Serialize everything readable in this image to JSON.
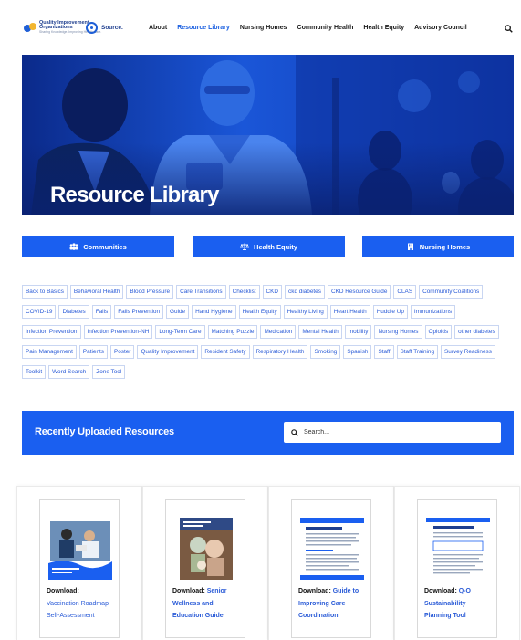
{
  "header": {
    "logo_line1": "Quality Improvement",
    "logo_line2": "Organizations",
    "logo_line3": "Sharing Knowledge. Improving Health Care.",
    "partner": "Source.",
    "nav": [
      "About",
      "Resource Library",
      "Nursing Homes",
      "Community Health",
      "Health Equity",
      "Advisory Council"
    ],
    "active_nav": "Resource Library",
    "search_icon": "search-icon"
  },
  "hero": {
    "title": "Resource Library"
  },
  "categories": [
    {
      "label": "Communities",
      "icon": "people-group-icon"
    },
    {
      "label": "Health Equity",
      "icon": "balance-scale-icon"
    },
    {
      "label": "Nursing Homes",
      "icon": "building-icon"
    }
  ],
  "tags": [
    "Back to Basics",
    "Behavioral Health",
    "Blood Pressure",
    "Care Transitions",
    "Checklist",
    "CKD",
    "ckd diabetes",
    "CKD Resource Guide",
    "CLAS",
    "Community Coalitions",
    "COVID-19",
    "Diabetes",
    "Falls",
    "Falls Prevention",
    "Guide",
    "Hand Hygiene",
    "Health Equity",
    "Healthy Living",
    "Heart Health",
    "Huddle Up",
    "Immunizations",
    "Infection Prevention",
    "Infection Prevention-NH",
    "Long-Term Care",
    "Matching Puzzle",
    "Medication",
    "Mental Health",
    "mobility",
    "Nursing Homes",
    "Opioids",
    "other diabetes",
    "Pain Management",
    "Patients",
    "Poster",
    "Quality Improvement",
    "Resident Safety",
    "Respiratory Health",
    "Smoking",
    "Spanish",
    "Staff",
    "Staff Training",
    "Survey Readiness",
    "Toolkit",
    "Word Search",
    "Zone Tool"
  ],
  "recent": {
    "title": "Recently Uploaded Resources",
    "search_placeholder": "Search..."
  },
  "cards": [
    {
      "download_label": "Download:",
      "title": "Vaccination Roadmap Self-Assessment"
    },
    {
      "download_label": "Download:",
      "title": "Senior Wellness and Education Guide"
    },
    {
      "download_label": "Download:",
      "title": "Guide to Improving Care Coordination"
    },
    {
      "download_label": "Download:",
      "title": "Q-O Sustainability Planning Tool"
    }
  ],
  "colors": {
    "primary": "#1a5ff0",
    "tag_text": "#2a5bd7",
    "hero_overlay": "#0d2f9a"
  }
}
